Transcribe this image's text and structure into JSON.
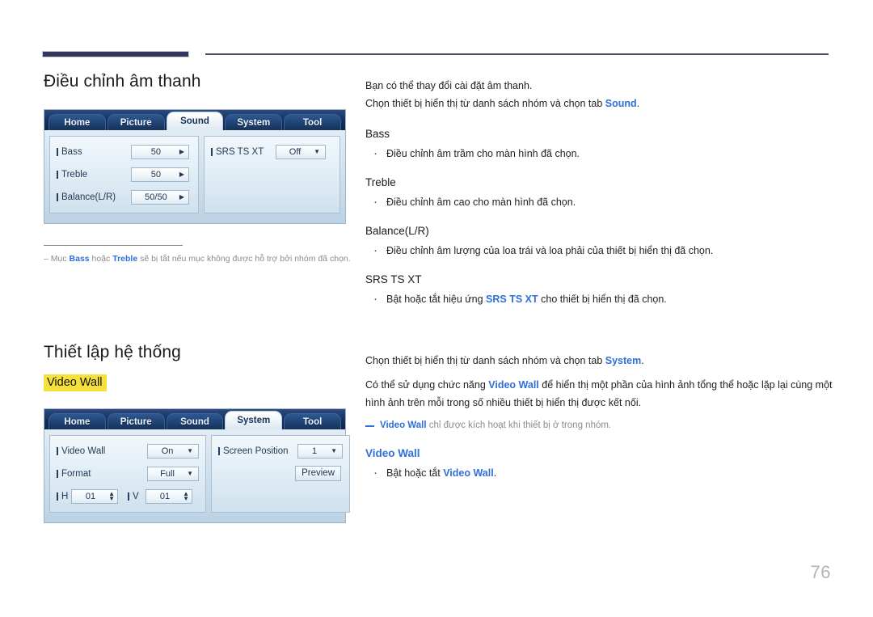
{
  "page": {
    "number": "76"
  },
  "sound_section": {
    "title": "Điều chỉnh âm thanh",
    "osd": {
      "tabs": [
        {
          "label": "Home",
          "active": false
        },
        {
          "label": "Picture",
          "active": false
        },
        {
          "label": "Sound",
          "active": true
        },
        {
          "label": "System",
          "active": false
        },
        {
          "label": "Tool",
          "active": false
        }
      ],
      "left_rows": [
        {
          "label": "Bass",
          "value": "50",
          "control": "stepper-right"
        },
        {
          "label": "Treble",
          "value": "50",
          "control": "stepper-right"
        },
        {
          "label": "Balance(L/R)",
          "value": "50/50",
          "control": "stepper-right"
        }
      ],
      "right_rows": [
        {
          "label": "SRS TS XT",
          "value": "Off",
          "control": "dropdown"
        }
      ]
    },
    "note": {
      "dash": "–",
      "pre": " Mục ",
      "b1": "Bass",
      "mid": " hoặc ",
      "b2": "Treble",
      "post": " sẽ bị tắt nếu mục không được hỗ trợ bởi nhóm đã chọn."
    },
    "intro": {
      "line1": "Bạn có thể thay đổi cài đặt âm thanh.",
      "line2_pre": "Chọn thiết bị hiển thị từ danh sách nhóm và chọn tab ",
      "line2_link": "Sound",
      "line2_post": "."
    },
    "options": [
      {
        "name": "Bass",
        "blue": false,
        "bullets": [
          "Điều chỉnh âm trầm cho màn hình đã chọn."
        ]
      },
      {
        "name": "Treble",
        "blue": false,
        "bullets": [
          "Điều chỉnh âm cao cho màn hình đã chọn."
        ]
      },
      {
        "name": "Balance(L/R)",
        "blue": false,
        "bullets": [
          "Điều chỉnh âm lượng của loa trái và loa phải của thiết bị hiển thị đã chọn."
        ]
      }
    ],
    "srs": {
      "name": "SRS TS XT",
      "bullet_pre": "Bật hoặc tắt hiệu ứng ",
      "bullet_link": "SRS TS XT",
      "bullet_post": " cho thiết bị hiển thị đã chọn."
    }
  },
  "system_section": {
    "title": "Thiết lập hệ thống",
    "highlight_label": "Video Wall",
    "osd": {
      "tabs": [
        {
          "label": "Home",
          "active": false
        },
        {
          "label": "Picture",
          "active": false
        },
        {
          "label": "Sound",
          "active": false
        },
        {
          "label": "System",
          "active": true
        },
        {
          "label": "Tool",
          "active": false
        }
      ],
      "left_rows": [
        {
          "label": "Video Wall",
          "value": "On",
          "control": "dropdown"
        },
        {
          "label": "Format",
          "value": "Full",
          "control": "dropdown"
        }
      ],
      "hv_row": {
        "h_label": "H",
        "h_value": "01",
        "v_label": "V",
        "v_value": "01"
      },
      "right_rows": [
        {
          "label": "Screen Position",
          "value": "1",
          "control": "dropdown"
        }
      ],
      "preview_button": "Preview"
    },
    "intro": {
      "line1_pre": "Chọn thiết bị hiển thị từ danh sách nhóm và chọn tab ",
      "line1_link": "System",
      "line1_post": ".",
      "line2_pre": "Có thể sử dụng chức năng ",
      "line2_link": "Video Wall",
      "line2_post": " để hiển thị một phần của hình ảnh tổng thể hoặc lặp lại cùng một hình ảnh trên mỗi trong số nhiều thiết bị hiển thị được kết nối."
    },
    "subnote": {
      "link": "Video Wall",
      "text": " chỉ được kích hoạt khi thiết bị ở trong nhóm."
    },
    "option": {
      "name": "Video Wall",
      "bullet_pre": "Bật hoặc tắt ",
      "bullet_link": "Video Wall",
      "bullet_post": "."
    }
  },
  "colors": {
    "link_blue": "#2f6fdb",
    "highlight_yellow": "#f5e03c",
    "osd_navy": "#14325f",
    "header_navy": "#32365e",
    "page_number_gray": "#b3b3b3"
  }
}
